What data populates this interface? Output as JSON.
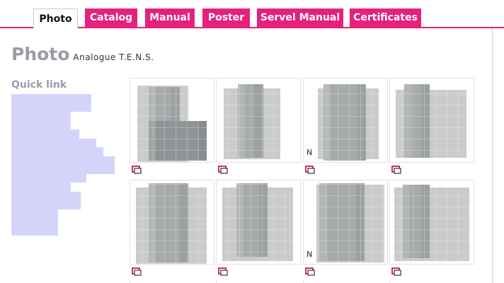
{
  "tabs": [
    {
      "label": "Photo",
      "active": true
    },
    {
      "label": "Catalog",
      "active": false
    },
    {
      "label": "Manual",
      "active": false
    },
    {
      "label": "Poster",
      "active": false
    },
    {
      "label": "Servel Manual",
      "active": false
    },
    {
      "label": "Certificates",
      "active": false
    }
  ],
  "page": {
    "title": "Photo",
    "subtitle": "Analogue T.E.N.S."
  },
  "quick_link": {
    "title": "Quick link",
    "items_count_visible_blurred": 16
  },
  "gallery": {
    "text_fragments": [
      "N",
      "N"
    ],
    "item_icon": "photo-viewer-icon"
  },
  "colors": {
    "accent": "#e6207d",
    "title_gray": "#9b9ca6",
    "quicklink_blur": "#d4d4fb"
  }
}
